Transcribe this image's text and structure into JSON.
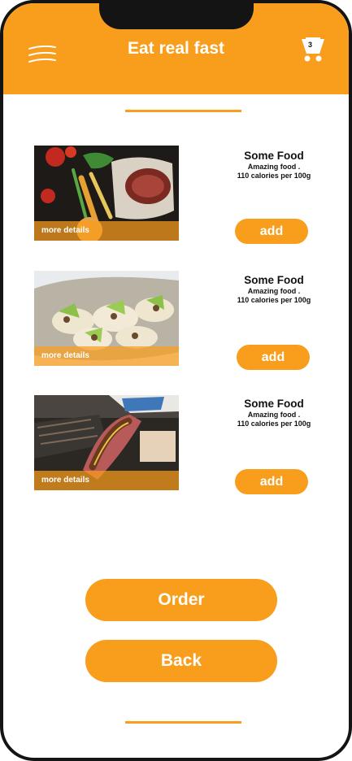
{
  "header": {
    "title": "Eat real fast",
    "menu_icon": "menu-icon",
    "cart_icon": "shopping-cart-icon",
    "cart_count": "3"
  },
  "colors": {
    "accent": "#f99d1c",
    "frame": "#141414",
    "background": "#ffffff"
  },
  "foods": [
    {
      "name": "Some Food",
      "description": "Amazing food .",
      "calories": "110 calories per 100g",
      "more_label": "more details",
      "add_label": "add",
      "image": "steak-vegetables-photo"
    },
    {
      "name": "Some Food",
      "description": "Amazing food .",
      "calories": "110 calories per 100g",
      "more_label": "more details",
      "add_label": "add",
      "image": "salad-toast-platter-photo"
    },
    {
      "name": "Some Food",
      "description": "Amazing food .",
      "calories": "110 calories per 100g",
      "more_label": "more details",
      "add_label": "add",
      "image": "hotdog-street-food-photo"
    }
  ],
  "actions": {
    "order_label": "Order",
    "back_label": "Back"
  }
}
